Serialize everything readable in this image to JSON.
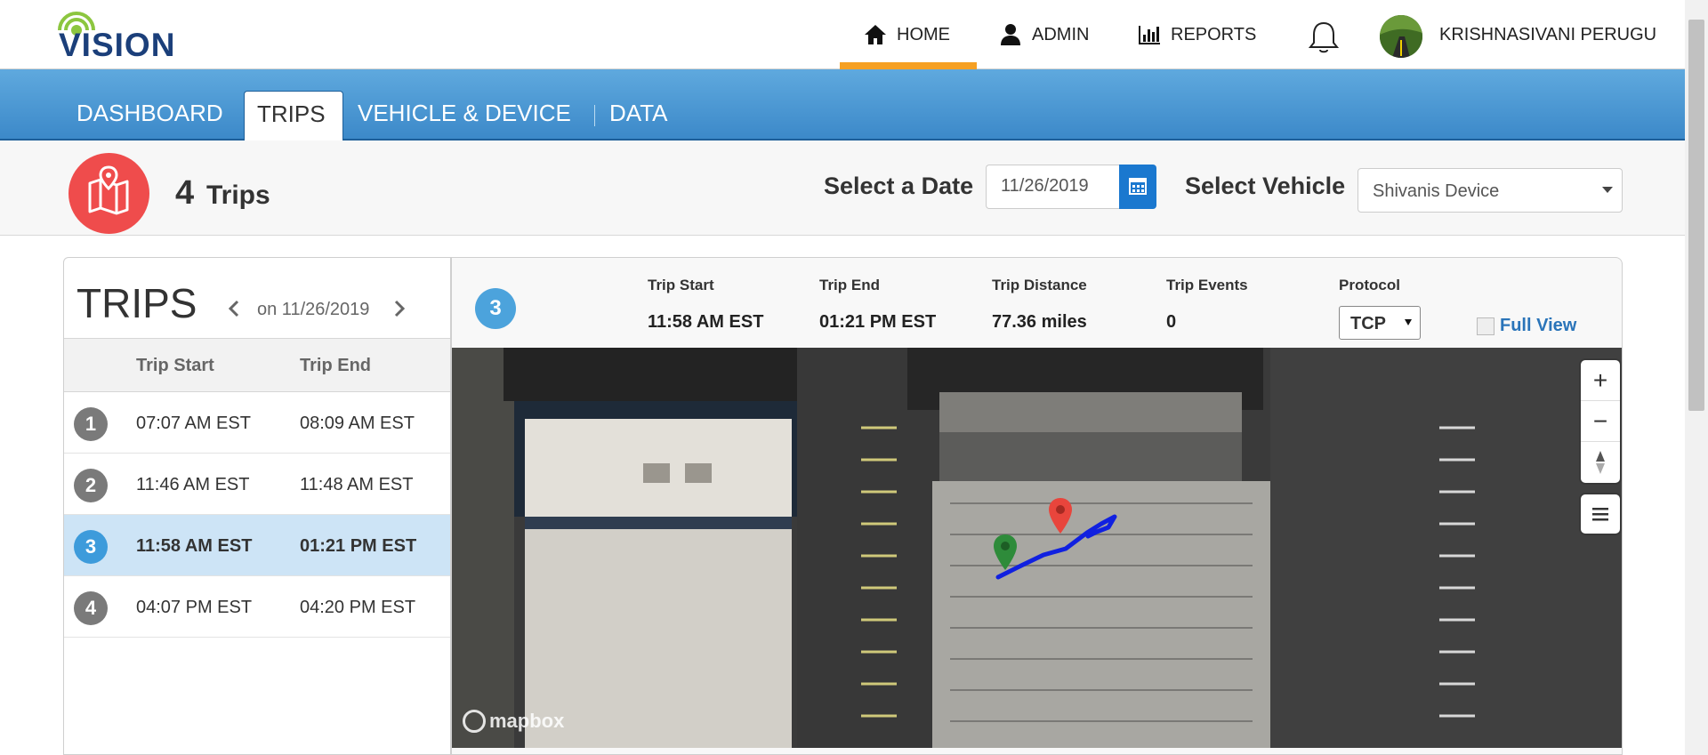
{
  "brand": {
    "name": "VISION"
  },
  "topnav": {
    "home": "HOME",
    "admin": "ADMIN",
    "reports": "REPORTS",
    "user": "KRISHNASIVANI PERUGU",
    "active": "HOME",
    "active_color": "#f5a023"
  },
  "tabs": [
    "DASHBOARD",
    "TRIPS",
    "VEHICLE & DEVICE",
    "DATA"
  ],
  "active_tab": "TRIPS",
  "summary": {
    "trip_count": "4",
    "trip_count_label": "Trips",
    "select_date_label": "Select a Date",
    "date_value": "11/26/2019",
    "select_vehicle_label": "Select Vehicle",
    "vehicle_value": "Shivanis Device"
  },
  "trips_panel": {
    "title": "TRIPS",
    "date_nav": "on 11/26/2019",
    "columns": [
      "Trip Start",
      "Trip End"
    ],
    "rows": [
      {
        "num": "1",
        "start": "07:07 AM EST",
        "end": "08:09 AM EST"
      },
      {
        "num": "2",
        "start": "11:46 AM EST",
        "end": "11:48 AM EST"
      },
      {
        "num": "3",
        "start": "11:58 AM EST",
        "end": "01:21 PM EST"
      },
      {
        "num": "4",
        "start": "04:07 PM EST",
        "end": "04:20 PM EST"
      }
    ],
    "selected_row": "3",
    "selected_color": "#cde4f6"
  },
  "detail": {
    "badge": "3",
    "trip_start_label": "Trip Start",
    "trip_start": "11:58 AM EST",
    "trip_end_label": "Trip End",
    "trip_end": "01:21 PM EST",
    "distance_label": "Trip Distance",
    "distance": "77.36 miles",
    "events_label": "Trip Events",
    "events": "0",
    "protocol_label": "Protocol",
    "protocol": "TCP",
    "full_view": "Full View"
  },
  "map": {
    "attribution": "mapbox",
    "zoom_in": "+",
    "zoom_out": "−",
    "start_marker_color": "#2e8b3a",
    "end_marker_color": "#e8453c",
    "route_color": "#1020e0"
  },
  "icons": [
    "home-icon",
    "user-icon",
    "bar-chart-icon",
    "bell-icon",
    "map-pin-icon",
    "calendar-icon",
    "chevron-left-icon",
    "chevron-right-icon",
    "compass-icon",
    "menu-icon",
    "expand-icon"
  ]
}
